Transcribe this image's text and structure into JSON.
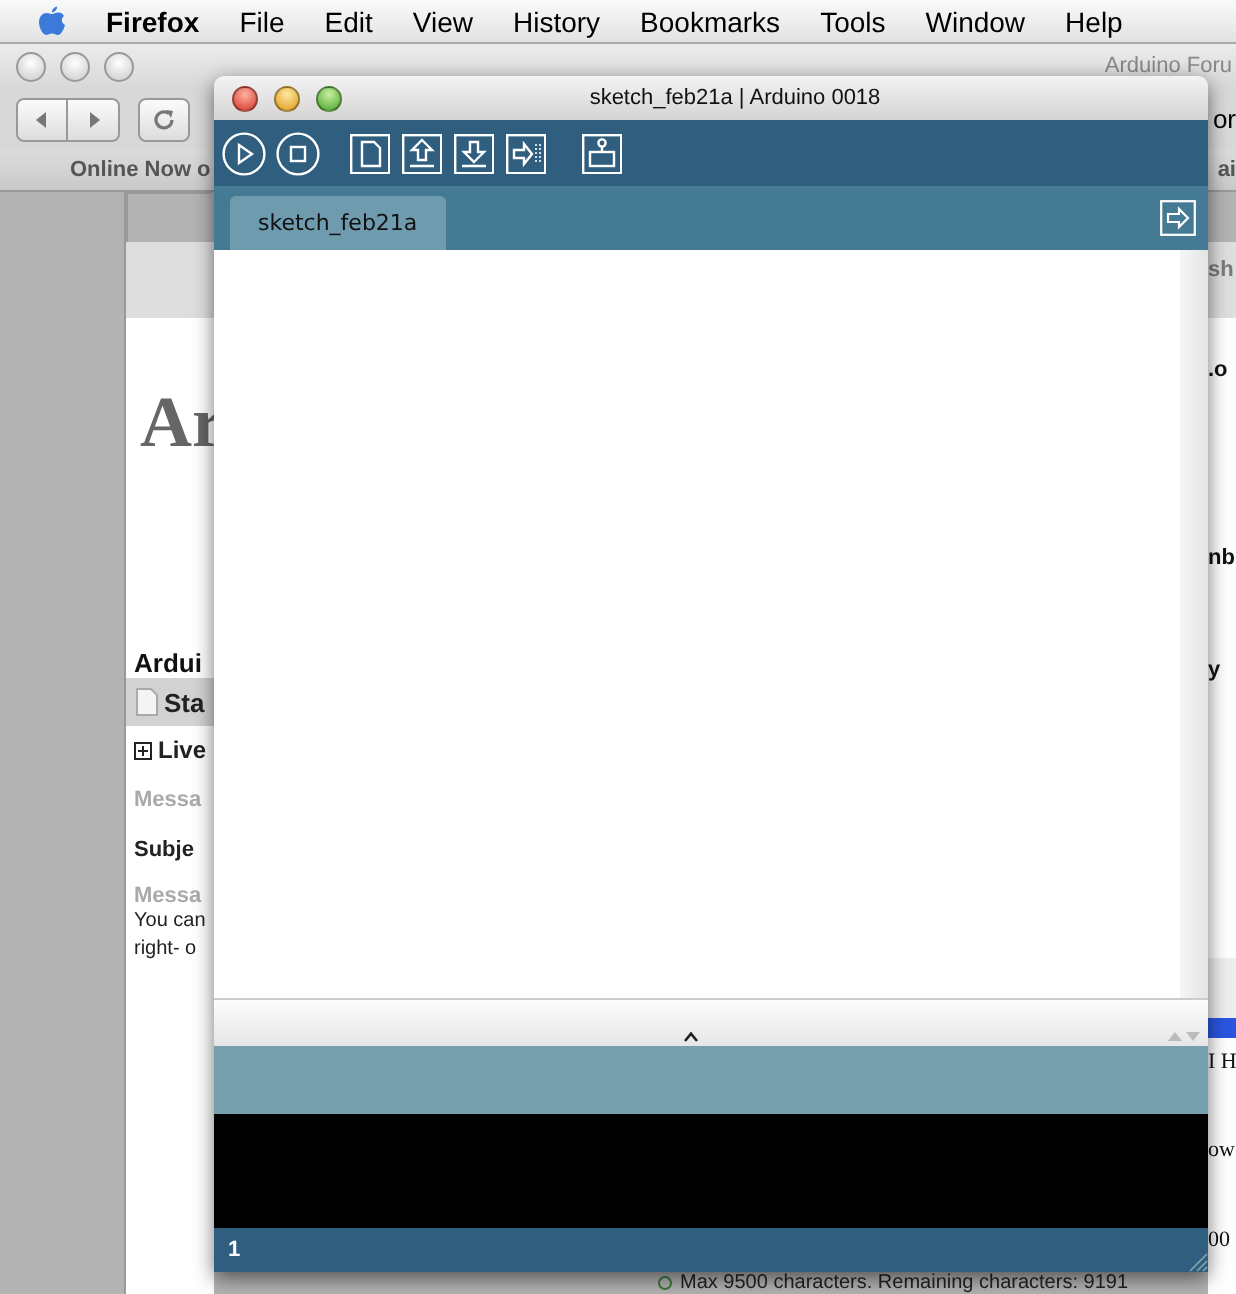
{
  "menu_bar": {
    "app": "Firefox",
    "items": [
      "File",
      "Edit",
      "View",
      "History",
      "Bookmarks",
      "Tools",
      "Window",
      "Help"
    ]
  },
  "browser": {
    "title": "Arduino Foru",
    "toolbar_right": "or",
    "bookmarks_bar": {
      "left": "Online Now o",
      "right": "ai"
    },
    "page": {
      "left": [
        {
          "kind": "logo",
          "text": "Ar"
        },
        {
          "kind": "heading",
          "text": "Ardui"
        },
        {
          "kind": "band",
          "text": "Sta"
        },
        {
          "kind": "expander",
          "text": "Live"
        },
        {
          "kind": "muted",
          "text": "Messa"
        },
        {
          "kind": "label",
          "text": "Subje"
        },
        {
          "kind": "muted",
          "text": "Messa"
        },
        {
          "kind": "text",
          "text": "You can"
        },
        {
          "kind": "text",
          "text": "right- o"
        }
      ],
      "right": [
        {
          "kind": "band",
          "text": "sh"
        },
        {
          "kind": "bold",
          "text": ".o"
        },
        {
          "kind": "bold",
          "text": "nb"
        },
        {
          "kind": "bold",
          "text": "y"
        },
        {
          "kind": "field"
        },
        {
          "kind": "serif",
          "text": "I H"
        },
        {
          "kind": "serif",
          "text": "ow"
        },
        {
          "kind": "serif",
          "text": "00"
        }
      ],
      "footer": "Max 9500 characters. Remaining characters: 9191"
    }
  },
  "ide": {
    "title": "sketch_feb21a | Arduino 0018",
    "tabs": [
      {
        "label": "sketch_feb21a",
        "selected": true
      }
    ],
    "status_line": "1"
  }
}
